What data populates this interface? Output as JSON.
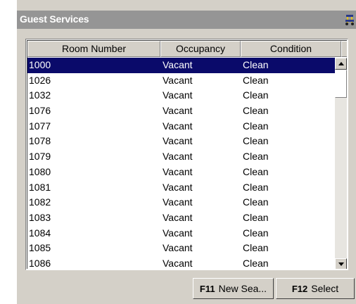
{
  "window": {
    "title": "Guest Services"
  },
  "table": {
    "columns": [
      "Room Number",
      "Occupancy",
      "Condition"
    ],
    "rows": [
      [
        "1000",
        "Vacant",
        "Clean"
      ],
      [
        "1026",
        "Vacant",
        "Clean"
      ],
      [
        "1032",
        "Vacant",
        "Clean"
      ],
      [
        "1076",
        "Vacant",
        "Clean"
      ],
      [
        "1077",
        "Vacant",
        "Clean"
      ],
      [
        "1078",
        "Vacant",
        "Clean"
      ],
      [
        "1079",
        "Vacant",
        "Clean"
      ],
      [
        "1080",
        "Vacant",
        "Clean"
      ],
      [
        "1081",
        "Vacant",
        "Clean"
      ],
      [
        "1082",
        "Vacant",
        "Clean"
      ],
      [
        "1083",
        "Vacant",
        "Clean"
      ],
      [
        "1084",
        "Vacant",
        "Clean"
      ],
      [
        "1085",
        "Vacant",
        "Clean"
      ],
      [
        "1086",
        "Vacant",
        "Clean"
      ]
    ]
  },
  "buttons": {
    "new_search": {
      "key": "F11",
      "label": "New Sea..."
    },
    "select": {
      "key": "F12",
      "label": "Select"
    }
  },
  "colors": {
    "title_bar": "#959595",
    "selection": "#0a0a6a",
    "panel": "#d4d0c8"
  },
  "icons": {
    "title": "bellhop-cart-icon"
  }
}
